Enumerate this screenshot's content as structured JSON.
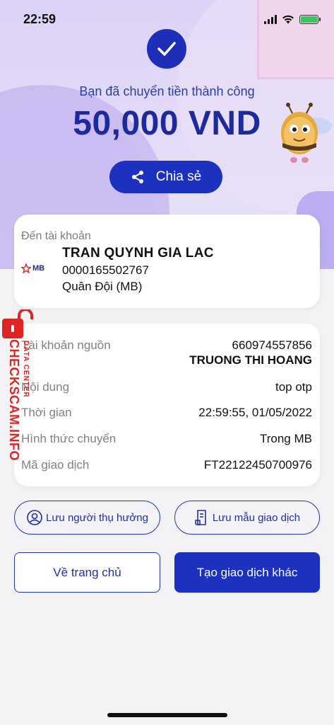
{
  "status_bar": {
    "time": "22:59"
  },
  "header": {
    "success_message": "Bạn đã chuyển tiền thành công",
    "amount": "50,000 VND",
    "share_label": "Chia sẻ"
  },
  "destination": {
    "label": "Đến tài khoản",
    "bank_logo_text": "MB",
    "account_name": "TRAN QUYNH GIA LAC",
    "account_number": "0000165502767",
    "bank_name": "Quân Đội (MB)"
  },
  "details": {
    "source_label": "Tài khoản nguồn",
    "source_account": "660974557856",
    "source_name": "TRUONG THI HOANG",
    "content_label": "Nội dung",
    "content_value": "top otp",
    "time_label": "Thời gian",
    "time_value": "22:59:55, 01/05/2022",
    "method_label": "Hình thức chuyển",
    "method_value": "Trong MB",
    "txn_label": "Mã giao dịch",
    "txn_value": "FT22122450700976"
  },
  "watermark": {
    "main": "CHECKSCAM.INFO",
    "sub": "DATA CENTER"
  },
  "actions": {
    "save_beneficiary": "Lưu người thụ hưởng",
    "save_template": "Lưu mẫu giao dịch",
    "home": "Về trang chủ",
    "new_transaction": "Tạo giao dịch khác"
  },
  "colors": {
    "primary": "#1d31c1",
    "amount_text": "#1c2a9d",
    "watermark": "#e02424",
    "battery": "#34c759"
  },
  "icons": {
    "check": "check-icon",
    "share": "share-icon",
    "user_circle": "user-circle-icon",
    "document": "document-icon",
    "lock": "lock-icon",
    "bank_star": "mb-star-icon"
  }
}
